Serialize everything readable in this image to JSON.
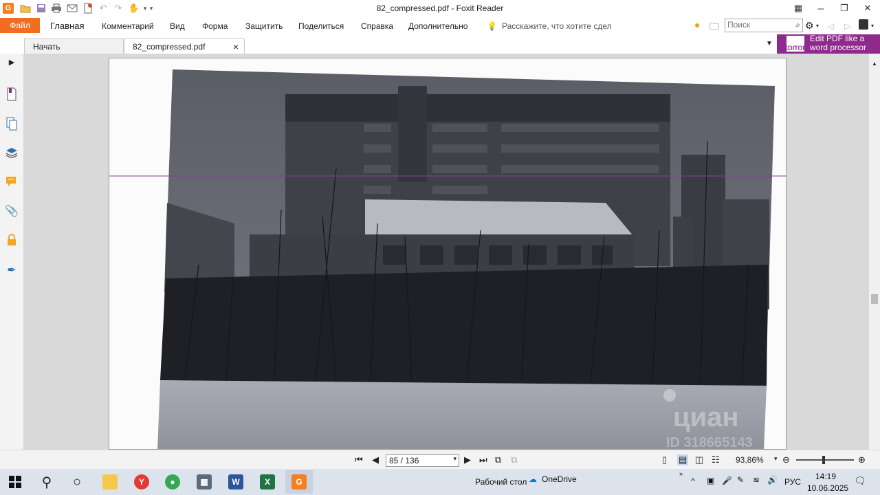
{
  "window": {
    "title": "82_compressed.pdf - Foxit Reader",
    "app_logo_letter": "G"
  },
  "quick_access": [
    "open-icon",
    "save-icon",
    "print-icon",
    "email-icon",
    "new-icon",
    "undo-icon",
    "redo-icon",
    "hand-tool-icon"
  ],
  "menu": {
    "file": "Файл",
    "items": [
      "Главная",
      "Комментарий",
      "Вид",
      "Форма",
      "Защитить",
      "Поделиться",
      "Справка",
      "Дополнительно"
    ],
    "tell_me": "Расскажите, что хотите сдел",
    "search_placeholder": "Поиск"
  },
  "tabs": [
    {
      "label": "Начать"
    },
    {
      "label": "82_compressed.pdf",
      "close": "×"
    }
  ],
  "promo": {
    "logo_text": "EDITOR",
    "line1": "Edit PDF like a",
    "line2": "word processor"
  },
  "document": {
    "watermark": "циан",
    "watermark_id": "ID 318665143"
  },
  "navigation": {
    "page_value": "85 / 136",
    "zoom": "93,86%"
  },
  "taskbar": {
    "apps": [
      "file-explorer-icon",
      "yandex-browser-icon",
      "chrome-icon",
      "calculator-icon",
      "word-icon",
      "excel-icon",
      "foxit-icon"
    ],
    "desktop_label": "Рабочий стол",
    "onedrive_label": "OneDrive",
    "language": "РУС",
    "time": "14:19",
    "date": "10.06.2025"
  },
  "colors": {
    "file_tab": "#f26c21",
    "promo_bg": "#8e2a8c",
    "taskbar_bg": "#dde3ec"
  }
}
